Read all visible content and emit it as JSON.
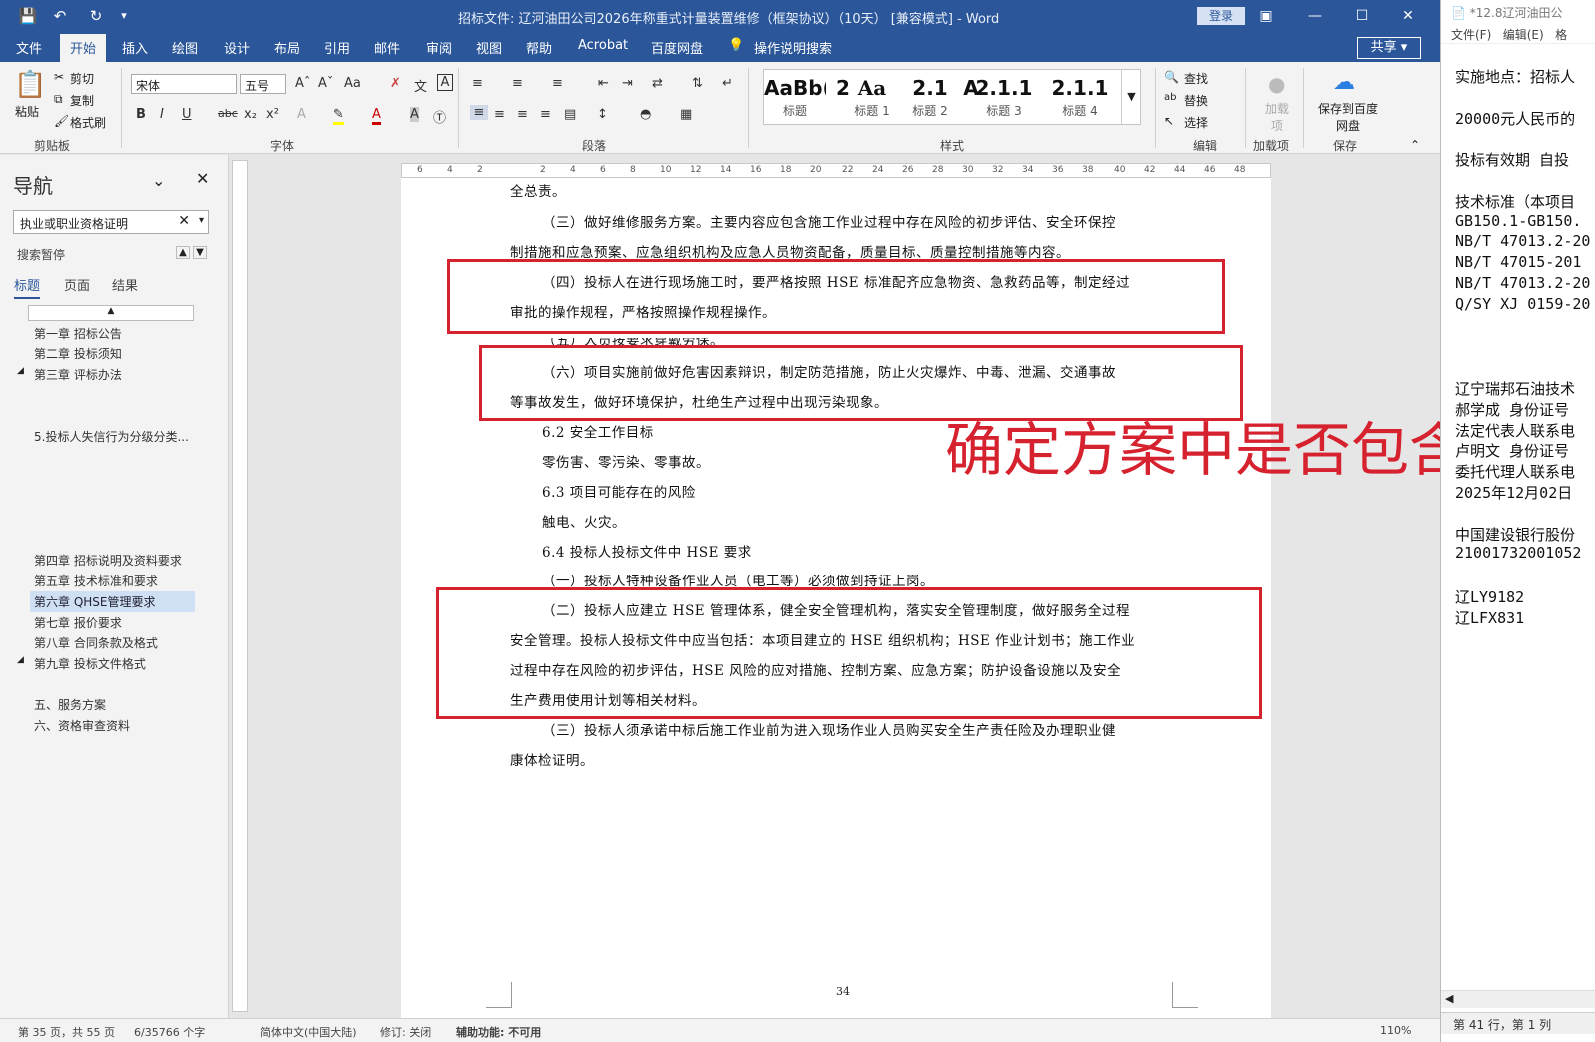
{
  "titlebar": {
    "title": "招标文件: 辽河油田公司2026年称重式计量装置维修（框架协议）（10天） [兼容模式] - Word",
    "login": "登录"
  },
  "tabs": [
    "文件",
    "开始",
    "插入",
    "绘图",
    "设计",
    "布局",
    "引用",
    "邮件",
    "审阅",
    "视图",
    "帮助",
    "Acrobat",
    "百度网盘"
  ],
  "tell_me": "操作说明搜索",
  "share": "共享",
  "ribbon": {
    "paste": "粘贴",
    "cut": "剪切",
    "copy": "复制",
    "format_painter": "格式刷",
    "clipboard": "剪贴板",
    "font_name": "宋体",
    "font_size": "五号",
    "font": "字体",
    "paragraph": "段落",
    "styles_label": "样式",
    "styles": [
      {
        "sample": "AaBb(",
        "name": "标题"
      },
      {
        "sample": "2",
        "name": "标题 1"
      },
      {
        "sample": "Aa",
        "name": "标题 2"
      },
      {
        "sample": "2.1",
        "name": "标题 2"
      },
      {
        "sample": "A",
        "name": "标题 3"
      },
      {
        "sample": "2.1.1",
        "name": "标题 3"
      },
      {
        "sample": "2.1.1",
        "name": "标题 4"
      }
    ],
    "find": "查找",
    "replace": "替换",
    "select": "选择",
    "editing": "编辑",
    "addin": "加载项",
    "addin_label": "加载项",
    "save_baidu": "保存到百度网盘",
    "save_group": "保存"
  },
  "nav": {
    "title": "导航",
    "search_value": "执业或职业资格证明",
    "paused": "搜索暂停",
    "tabs": [
      "标题",
      "页面",
      "结果"
    ],
    "items": [
      "第一章  招标公告",
      "第二章  投标须知",
      "第三章  评标办法",
      "5.投标人失信行为分级分类...",
      "第四章  招标说明及资料要求",
      "第五章  技术标准和要求",
      "第六章  QHSE管理要求",
      "第七章  报价要求",
      "第八章  合同条款及格式",
      "第九章  投标文件格式",
      "五、服务方案",
      "六、资格审查资料"
    ]
  },
  "ruler_ticks": [
    "6",
    "4",
    "2",
    "2",
    "4",
    "6",
    "8",
    "10",
    "12",
    "14",
    "16",
    "18",
    "20",
    "22",
    "24",
    "26",
    "28",
    "30",
    "32",
    "34",
    "36",
    "38",
    "40",
    "42",
    "44",
    "46",
    "48"
  ],
  "doc": {
    "lines": [
      "全总责。",
      "（三）做好维修服务方案。主要内容应包含施工作业过程中存在风险的初步评估、安全环保控",
      "制措施和应急预案、应急组织机构及应急人员物资配备，质量目标、质量控制措施等内容。",
      "（四）投标人在进行现场施工时，要严格按照 HSE 标准配齐应急物资、急救药品等，制定经过",
      "审批的操作规程，严格按照操作规程操作。",
      "（五）人员按要求穿戴劳保。",
      "（六）项目实施前做好危害因素辩识，制定防范措施，防止火灾爆炸、中毒、泄漏、交通事故",
      "等事故发生，做好环境保护，杜绝生产过程中出现污染现象。",
      "6.2 安全工作目标",
      "零伤害、零污染、零事故。",
      "6.3 项目可能存在的风险",
      "触电、火灾。",
      "6.4 投标人投标文件中 HSE 要求",
      "（一）投标人特种设备作业人员（电工等）必须做到持证上岗。",
      "（二）投标人应建立 HSE 管理体系，健全安全管理机构，落实安全管理制度，做好服务全过程",
      "安全管理。投标人投标文件中应当包括：本项目建立的 HSE 组织机构；HSE 作业计划书；施工作业",
      "过程中存在风险的初步评估，HSE 风险的应对措施、控制方案、应急方案；防护设备设施以及安全",
      "生产费用使用计划等相关材料。",
      "（三）投标人须承诺中标后施工作业前为进入现场作业人员购买安全生产责任险及办理职业健",
      "康体检证明。"
    ],
    "page_number": "34",
    "annotation": "确定方案中是否包含"
  },
  "status": {
    "page": "第 35 页，共 55 页",
    "words": "6/35766 个字",
    "lang": "简体中文(中国大陆)",
    "track": "修订: 关闭",
    "access": "辅助功能: 不可用",
    "zoom": "110%"
  },
  "notepad": {
    "title": "*12.8辽河油田公",
    "menu": [
      "文件(F)",
      "编辑(E)",
      "格"
    ],
    "lines": [
      "实施地点：招标人",
      "",
      "20000元人民币的",
      "",
      "投标有效期 自投",
      "",
      "技术标准（本项目",
      "GB150.1-GB150.",
      "NB/T 47013.2-20",
      "NB/T 47015-201",
      "NB/T 47013.2-20",
      "Q/SY XJ 0159-20",
      "",
      "",
      "",
      "辽宁瑞邦石油技术",
      "郝学成   身份证号",
      "法定代表人联系电",
      "卢明文   身份证号",
      "委托代理人联系电",
      "2025年12月02日",
      "",
      "中国建设银行股份",
      "21001732001052",
      "",
      "辽LY9182",
      "辽LFX831"
    ],
    "status": "第 41 行，第 1 列"
  }
}
